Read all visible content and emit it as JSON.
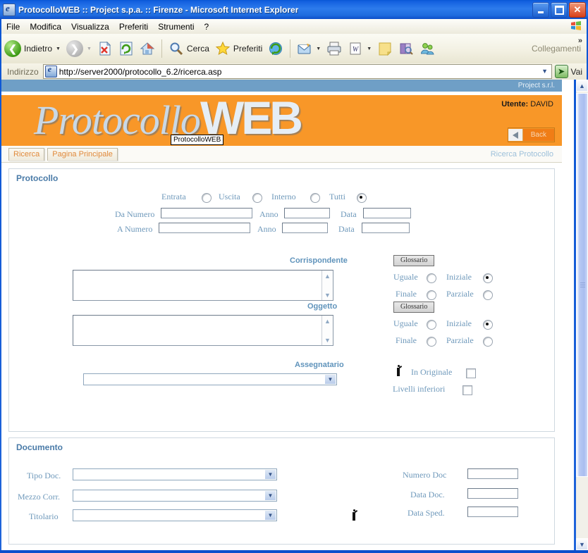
{
  "window": {
    "title": "ProtocolloWEB :: Project s.p.a. :: Firenze - Microsoft Internet Explorer",
    "minimize_label": "Minimize",
    "maximize_label": "Maximize",
    "close_label": "Close"
  },
  "menu": {
    "items": [
      "File",
      "Modifica",
      "Visualizza",
      "Preferiti",
      "Strumenti",
      "?"
    ]
  },
  "toolbar": {
    "back_label": "Indietro",
    "forward_label": "",
    "stop_label": "",
    "refresh_label": "",
    "home_label": "",
    "search_label": "Cerca",
    "favorites_label": "Preferiti",
    "history_label": "",
    "mail_label": "",
    "print_label": "",
    "edit_label": "",
    "discuss_label": "",
    "research_label": "",
    "messenger_label": "",
    "links_label": "Collegamenti",
    "overflow_label": "»"
  },
  "address": {
    "label": "Indirizzo",
    "url": "http://server2000/protocollo_6.2/ricerca.asp",
    "go_label": "Vai"
  },
  "page": {
    "company": "Project s.r.l.",
    "logo_main": "Protocollo",
    "logo_accent": "WEB",
    "tooltip": "ProtocolloWEB",
    "user_label": "Utente:",
    "user_name": "DAVID",
    "back_button": "Back",
    "tabs": [
      {
        "label": "Ricerca"
      },
      {
        "label": "Pagina Principale"
      }
    ],
    "breadcrumb": "Ricerca Protocollo"
  },
  "protocollo": {
    "title": "Protocollo",
    "type_options": [
      {
        "label": "Entrata",
        "selected": false
      },
      {
        "label": "Uscita",
        "selected": false
      },
      {
        "label": "Interno",
        "selected": false
      },
      {
        "label": "Tutti",
        "selected": true
      }
    ],
    "rows": [
      {
        "num_label": "Da Numero",
        "num_value": "",
        "anno_label": "Anno",
        "anno_value": "",
        "data_label": "Data",
        "data_value": ""
      },
      {
        "num_label": "A Numero",
        "num_value": "",
        "anno_label": "Anno",
        "anno_value": "",
        "data_label": "Data",
        "data_value": ""
      }
    ],
    "corrispondente": {
      "label": "Corrispondente",
      "value": "",
      "glossario_label": "Glossario",
      "match_options": [
        {
          "label": "Uguale",
          "selected": false
        },
        {
          "label": "Iniziale",
          "selected": true
        },
        {
          "label": "Finale",
          "selected": false
        },
        {
          "label": "Parziale",
          "selected": false
        }
      ]
    },
    "oggetto": {
      "label": "Oggetto",
      "value": "",
      "glossario_label": "Glossario",
      "match_options": [
        {
          "label": "Uguale",
          "selected": false
        },
        {
          "label": "Iniziale",
          "selected": true
        },
        {
          "label": "Finale",
          "selected": false
        },
        {
          "label": "Parziale",
          "selected": false
        }
      ]
    },
    "assegnatario": {
      "label": "Assegnatario",
      "value": "",
      "checkboxes": [
        {
          "label": "In Originale",
          "checked": false
        },
        {
          "label": "Livelli inferiori",
          "checked": false
        }
      ]
    }
  },
  "documento": {
    "title": "Documento",
    "left_fields": [
      {
        "label": "Tipo Doc.",
        "value": ""
      },
      {
        "label": "Mezzo Corr.",
        "value": ""
      },
      {
        "label": "Titolario",
        "value": ""
      }
    ],
    "right_fields": [
      {
        "label": "Numero Doc",
        "value": ""
      },
      {
        "label": "Data Doc.",
        "value": ""
      },
      {
        "label": "Data Sped.",
        "value": ""
      }
    ]
  },
  "icons": {
    "browser": "ie-logo-icon",
    "search": "magnifier-icon",
    "favorites": "star-icon",
    "home": "home-icon",
    "mail": "mail-icon",
    "print": "printer-icon",
    "word": "word-icon",
    "notes": "note-icon",
    "research": "research-icon",
    "messenger": "messenger-icon"
  },
  "colors": {
    "banner_orange": "#f89728",
    "topbar_blue": "#6f9fc6",
    "label_blue": "#6f99bb",
    "title_blue": "#4a7ba8",
    "tab_orange": "#e08a3b"
  }
}
